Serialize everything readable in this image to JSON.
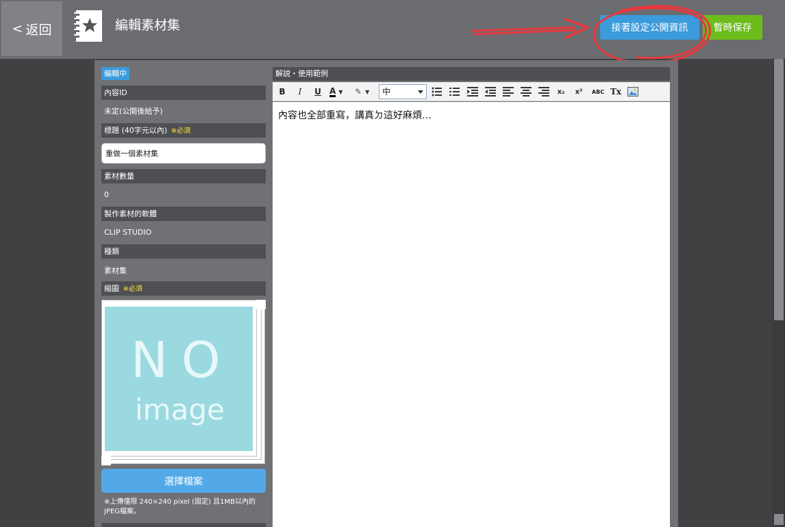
{
  "header": {
    "back_label": "返回",
    "title": "編輯素材集",
    "public_button_label": "接著設定公開資訊",
    "save_button_label": "暫時保存"
  },
  "left": {
    "status_badge": "編輯中",
    "content_id_label": "內容ID",
    "content_id_value": "未定(公開後給予)",
    "title_label": "標題 (40字元以內)",
    "required_mark": "※必須",
    "title_value": "重做一個素材集",
    "material_count_label": "素材數量",
    "material_count_value": "0",
    "software_label": "製作素材的軟體",
    "software_value": "CLIP STUDIO",
    "type_label": "種類",
    "type_value": "素材集",
    "thumbnail_label": "縮圖",
    "thumbnail_required": "※必須",
    "noimage_text_top": "NO",
    "noimage_text_bottom": "image",
    "choose_file_label": "選擇檔案",
    "upload_note": "※上傳僅限 240×240 pixel (固定) 且1MB以內的JPEG檔案。"
  },
  "editor": {
    "header": "解説・使用範例",
    "size_select_value": "中",
    "toolbar": {
      "bold": "B",
      "italic": "I",
      "underline": "U",
      "font_color": "A",
      "subscript": "x₂",
      "superscript": "x²",
      "spellcheck": "ABC",
      "clear_format": "Tx"
    },
    "content": "內容也全部重寫，講真ㄉ這好麻煩…"
  },
  "colors": {
    "header_bg": "#6b6c70",
    "primary_blue": "#3b9bdb",
    "save_green": "#6cbc1c",
    "required_yellow": "#ffe32b",
    "noimage_bg": "#9bd9e0",
    "annotation_red": "#e8383d"
  },
  "icons": {
    "app_icon": "star-notebook-icon",
    "back_icon": "chevron-left-icon"
  }
}
